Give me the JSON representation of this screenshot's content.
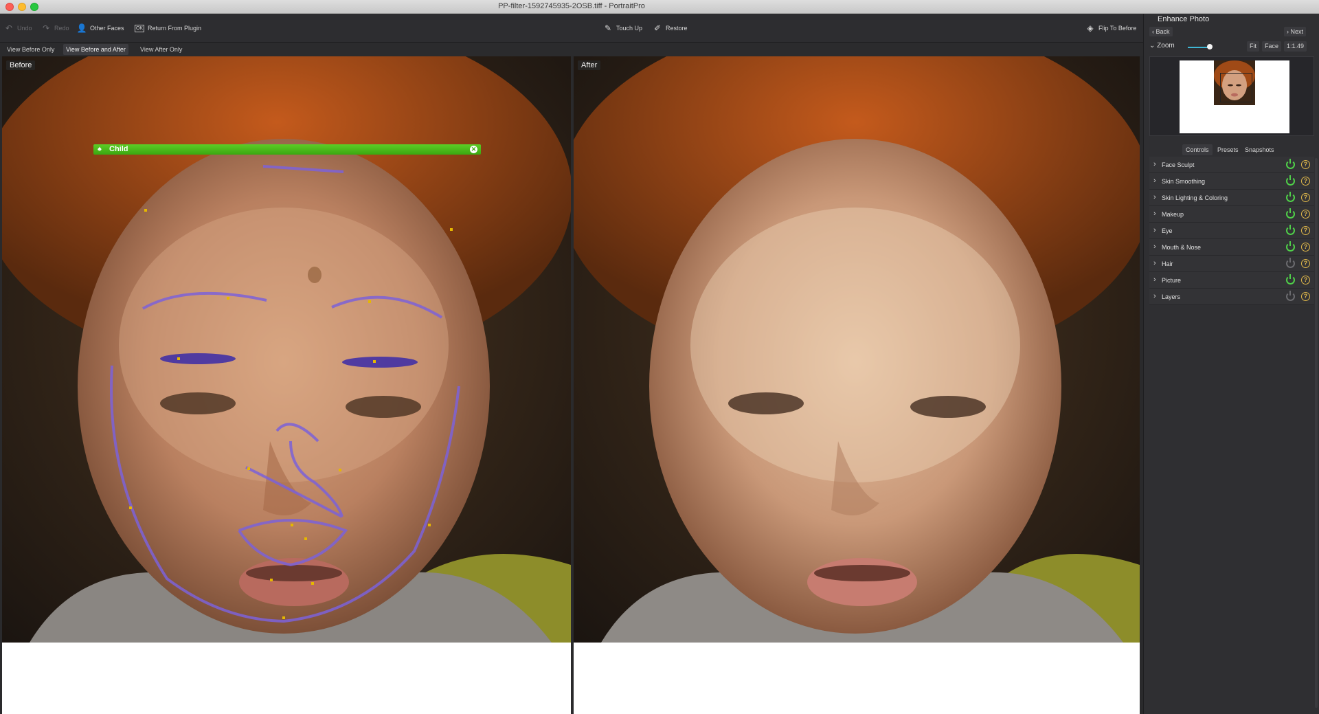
{
  "window": {
    "title": "PP-filter-1592745935-2OSB.tiff - PortraitPro"
  },
  "toolbar": {
    "undo": "Undo",
    "redo": "Redo",
    "other_faces": "Other Faces",
    "return_from_plugin": "Return From Plugin",
    "touch_up": "Touch Up",
    "restore": "Restore",
    "flip_to_before": "Flip To Before"
  },
  "view_tabs": [
    {
      "label": "View Before Only",
      "active": false
    },
    {
      "label": "View Before and After",
      "active": true
    },
    {
      "label": "View After Only",
      "active": false
    }
  ],
  "before_pane": {
    "label": "Before"
  },
  "after_pane": {
    "label": "After"
  },
  "face_label": {
    "name": "Child"
  },
  "panel": {
    "title": "Enhance Photo",
    "back": "Back",
    "next": "Next",
    "zoom_label": "Zoom",
    "zoom_fit": "Fit",
    "zoom_face": "Face",
    "zoom_ratio": "1:1.49",
    "tabs": [
      {
        "label": "Controls",
        "active": true
      },
      {
        "label": "Presets",
        "active": false
      },
      {
        "label": "Snapshots",
        "active": false
      }
    ],
    "controls": [
      {
        "label": "Face Sculpt",
        "enabled": true
      },
      {
        "label": "Skin Smoothing",
        "enabled": true
      },
      {
        "label": "Skin Lighting & Coloring",
        "enabled": true
      },
      {
        "label": "Makeup",
        "enabled": true
      },
      {
        "label": "Eye",
        "enabled": true
      },
      {
        "label": "Mouth & Nose",
        "enabled": true
      },
      {
        "label": "Hair",
        "enabled": false
      },
      {
        "label": "Picture",
        "enabled": true
      },
      {
        "label": "Layers",
        "enabled": false
      }
    ]
  },
  "colors": {
    "accent_green": "#3ba711",
    "slider_blue": "#3fb7d6",
    "help_yellow": "#e0b84a",
    "power_green": "#4fcf49"
  }
}
